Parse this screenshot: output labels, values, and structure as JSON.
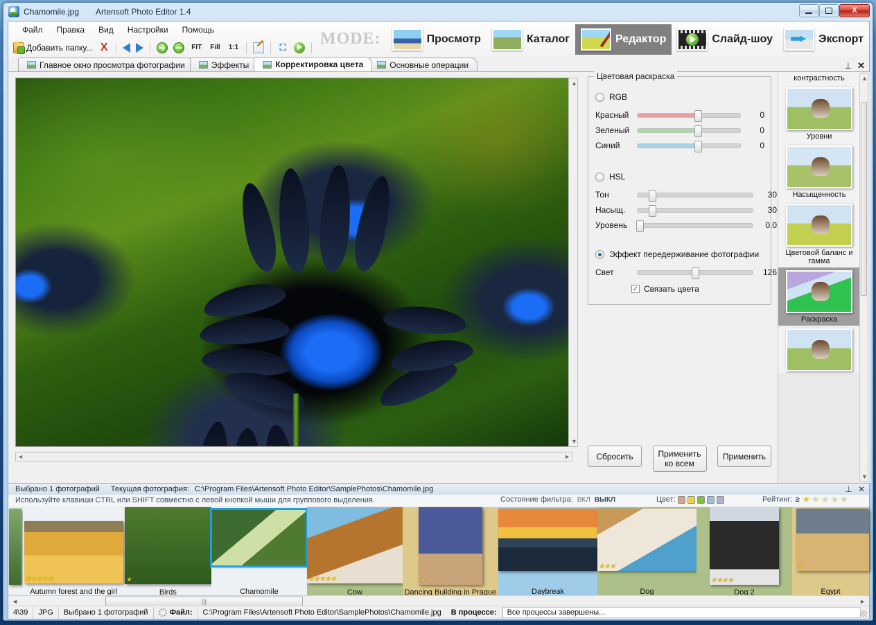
{
  "window": {
    "document_title": "Chamomile.jpg",
    "app_title": "Artensoft Photo Editor 1.4",
    "minimize_tip": "Свернуть",
    "maximize_tip": "Развернуть",
    "close_label": "X"
  },
  "menu": {
    "items": [
      "Файл",
      "Правка",
      "Вид",
      "Настройки",
      "Помощь"
    ]
  },
  "toolbar": {
    "add_folder_label": "Добавить папку...",
    "delete_label": "X",
    "fit_label": "FIT",
    "fill_label": "Fill",
    "oneone_label": "1:1"
  },
  "mode": {
    "word": "MODE:",
    "buttons": [
      {
        "label": "Просмотр",
        "active": false
      },
      {
        "label": "Каталог",
        "active": false
      },
      {
        "label": "Редактор",
        "active": true
      },
      {
        "label": "Слайд-шоу",
        "active": false
      },
      {
        "label": "Экспорт",
        "active": false
      }
    ]
  },
  "tabs": {
    "items": [
      {
        "label": "Главное окно просмотра фотографии",
        "active": false
      },
      {
        "label": "Эффекты",
        "active": false
      },
      {
        "label": "Корректировка цвета",
        "active": true
      },
      {
        "label": "Основные операции",
        "active": false
      }
    ],
    "pin": "⊥",
    "close": "✕"
  },
  "tools": {
    "group_title": "Цветовая раскраска",
    "rgb": {
      "radio_label": "RGB",
      "selected": false,
      "sliders": [
        {
          "label": "Красный",
          "value": "0",
          "pos": 0.59,
          "color": "#e6a2a2"
        },
        {
          "label": "Зеленый",
          "value": "0",
          "pos": 0.59,
          "color": "#aadaa2"
        },
        {
          "label": "Синий",
          "value": "0",
          "pos": 0.59,
          "color": "#a9d3e6"
        }
      ]
    },
    "hsl": {
      "radio_label": "HSL",
      "selected": false,
      "sliders": [
        {
          "label": "Тон",
          "value": "30",
          "pos": 0.1
        },
        {
          "label": "Насыщ.",
          "value": "30",
          "pos": 0.1
        },
        {
          "label": "Уровень",
          "value": "0.0",
          "pos": 0.0
        }
      ]
    },
    "overexposure": {
      "radio_label": "Эффект передерживание фотографии",
      "selected": true,
      "slider": {
        "label": "Свет",
        "value": "126",
        "pos": 0.47
      },
      "checkbox_label": "Связать цвета",
      "checkbox_checked": true,
      "check_glyph": "✓"
    },
    "buttons": {
      "reset": "Сбросить",
      "apply_all_line1": "Применить",
      "apply_all_line2": "ко всем",
      "apply": "Применить"
    }
  },
  "presets": {
    "items": [
      {
        "label": "контрастность",
        "selected": false,
        "partial": true
      },
      {
        "label": "Уровни",
        "selected": false
      },
      {
        "label": "Насыщенность",
        "selected": false
      },
      {
        "label": "Цветовой баланс и гамма",
        "selected": false
      },
      {
        "label": "Раскраска",
        "selected": true
      },
      {
        "label": "",
        "selected": false
      }
    ]
  },
  "filmstrip": {
    "header": {
      "selected_count_text": "Выбрано 1  фотографий",
      "current_label": "Текущая фотография:",
      "current_path": "C:\\Program Files\\Artensoft Photo Editor\\SamplePhotos\\Chamomile.jpg"
    },
    "hint": "Используйте клавиши CTRL или SHIFT совместно с левой кнопкой мыши для группового выделения.",
    "filter_state_label": "Состояние фильтра:",
    "filter_on": "ВКЛ",
    "filter_off": "ВЫКЛ",
    "color_label": "Цвет:",
    "color_swatches": [
      "#d8a48c",
      "#f0d24a",
      "#7dc23a",
      "#9dc0d8",
      "#b0b0cf"
    ],
    "rating_label": "Рейтинг:",
    "rating_operator": "≥",
    "rating_value": 1,
    "rating_max": 5,
    "photos": [
      {
        "caption": "Autumn forest and the girl",
        "stars": 5,
        "selected": false,
        "bg": "#eef1f4"
      },
      {
        "caption": "Birds",
        "stars": 1,
        "selected": false,
        "bg": "#eef1f4"
      },
      {
        "caption": "Chamomile",
        "stars": 0,
        "selected": true,
        "bg": "#eef1f4"
      },
      {
        "caption": "Cow",
        "stars": 5,
        "selected": false,
        "bg": "#adc089"
      },
      {
        "caption": "Dancing Building in Prague",
        "stars": 1,
        "selected": false,
        "bg": "#ddc98a"
      },
      {
        "caption": "Daybreak",
        "stars": 0,
        "selected": false,
        "bg": "#9fcce8"
      },
      {
        "caption": "Dog",
        "stars": 3,
        "selected": false,
        "bg": "#adc089"
      },
      {
        "caption": "Dog 2",
        "stars": 4,
        "selected": false,
        "bg": "#adc089"
      },
      {
        "caption": "Egypt",
        "stars": 1,
        "selected": false,
        "bg": "#ddc98a"
      }
    ]
  },
  "statusbar": {
    "index": "4\\39",
    "format": "JPG",
    "selection": "Выбрано 1 фотографий",
    "file_label": "Файл:",
    "file_path": "C:\\Program Files\\Artensoft Photo Editor\\SamplePhotos\\Chamomile.jpg",
    "process_label": "В процессе:",
    "process_value": "Все процессы завершены..."
  }
}
